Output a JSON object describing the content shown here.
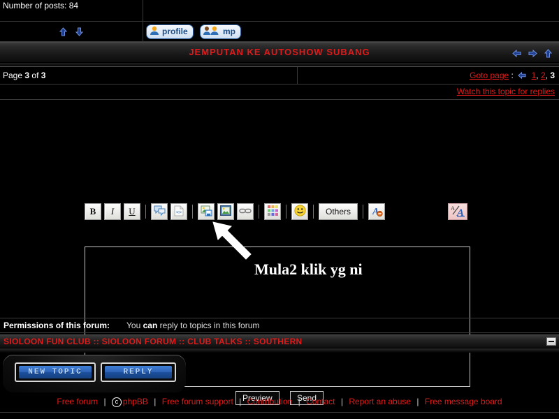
{
  "post": {
    "posts_label": "Number of posts: 84",
    "nav_up_icon": "arrow-up-icon",
    "nav_down_icon": "arrow-down-icon",
    "profile_button": "profile",
    "mp_button": "mp"
  },
  "topic": {
    "title": "JEMPUTAN KE AUTOSHOW SUBANG",
    "nav_icons": [
      "arrow-left-icon",
      "arrow-right-icon",
      "arrow-up-icon"
    ]
  },
  "pagination": {
    "page_prefix": "Page",
    "page_current": "3",
    "page_of": "of",
    "page_total": "3",
    "goto_label": "Goto page",
    "colon": ":",
    "prev_icon": "arrow-left-icon",
    "pages": [
      "1",
      "2",
      "3"
    ],
    "active_page": "3",
    "watch_label": "Watch this topic for replies"
  },
  "editor": {
    "toolbar": [
      {
        "name": "bold-button",
        "glyph": "B",
        "kind": "text"
      },
      {
        "name": "italic-button",
        "glyph": "I",
        "kind": "text"
      },
      {
        "name": "underline-button",
        "glyph": "U",
        "kind": "text"
      },
      {
        "name": "quote-button",
        "glyph": "quote-icon",
        "kind": "icon"
      },
      {
        "name": "code-button",
        "glyph": "code-icon",
        "kind": "icon"
      },
      {
        "name": "image-upload-button",
        "glyph": "image-save-icon",
        "kind": "icon"
      },
      {
        "name": "image-button",
        "glyph": "image-icon",
        "kind": "icon"
      },
      {
        "name": "link-button",
        "glyph": "link-icon",
        "kind": "icon"
      },
      {
        "name": "color-button",
        "glyph": "color-palette-icon",
        "kind": "icon"
      },
      {
        "name": "smiley-button",
        "glyph": "smiley-icon",
        "kind": "icon"
      },
      {
        "name": "others-button",
        "glyph": "Others",
        "kind": "label"
      },
      {
        "name": "remove-font-button",
        "glyph": "font-remove-icon",
        "kind": "icon"
      }
    ],
    "font_button": "font-size-icon",
    "message_value": "",
    "message_placeholder": "",
    "preview_button": "Preview",
    "send_button": "Send"
  },
  "annotation": {
    "text": "Mula2 klik yg ni",
    "arrow": "arrow-pointer"
  },
  "permissions": {
    "label": "Permissions of this forum:",
    "text_before": "You ",
    "text_can": "can",
    "text_after": " reply to topics in this forum"
  },
  "breadcrumb": {
    "items": [
      "SIOLOON FUN CLUB",
      "SIOLOON FORUM",
      "CLUB TALKS",
      "SOUTHERN"
    ],
    "separator": "::",
    "collapse_icon": "minus-icon"
  },
  "actions": {
    "new_topic": "NEW TOPIC",
    "reply": "REPLY"
  },
  "footer": {
    "links": [
      {
        "label": "Free forum",
        "icon": null
      },
      {
        "label": "phpBB",
        "icon": "copyright-icon"
      },
      {
        "label": "Free forum support",
        "icon": null
      },
      {
        "label": "Contribution",
        "icon": null
      },
      {
        "label": "Contact",
        "icon": null
      },
      {
        "label": "Report an abuse",
        "icon": null
      },
      {
        "label": "Free message board",
        "icon": null
      }
    ]
  },
  "colors": {
    "accent_red": "#e01b1b",
    "background": "#000000",
    "link_blue": "#3b6fd0",
    "button_blue": "#2f63b5"
  }
}
